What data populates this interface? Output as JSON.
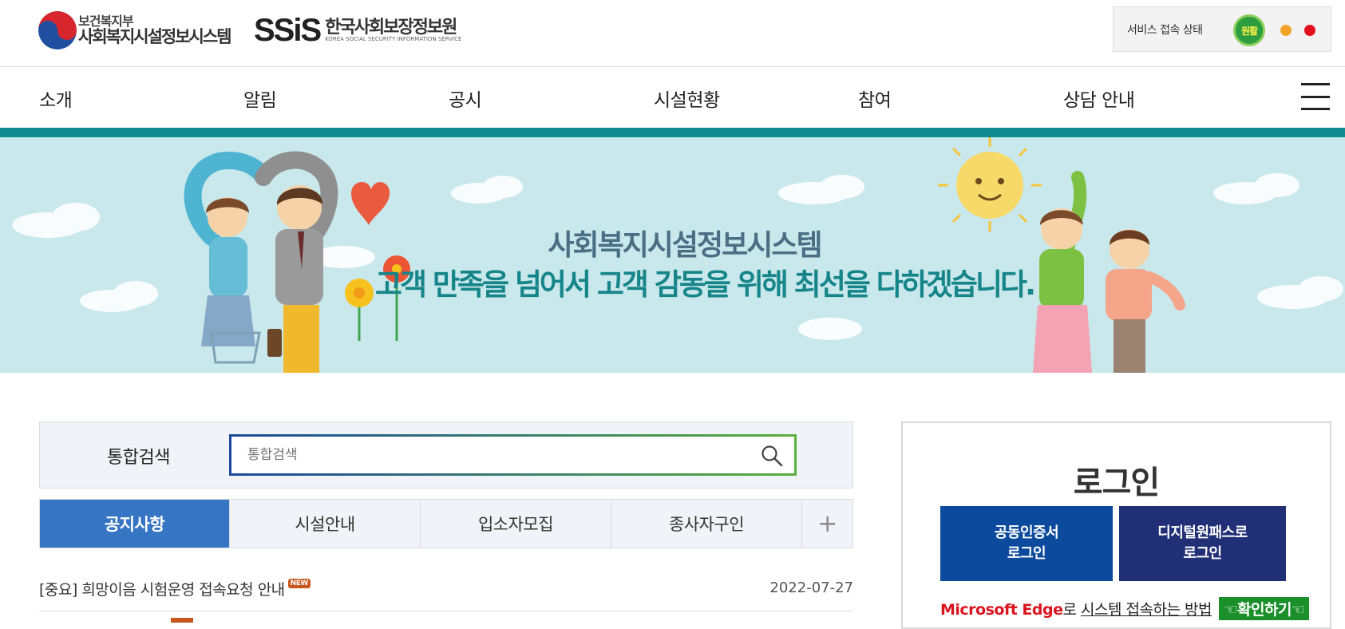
{
  "header": {
    "ministry_small": "보건복지부",
    "ministry_system": "사회복지시설정보시스템",
    "ssis_mark": "SSiS",
    "ssis_name": "한국사회보장정보원",
    "ssis_english": "KOREA SOCIAL SECURITY INFORMATION SERVICE",
    "service_status_label": "서비스 접속 상태",
    "service_status_value": "원활"
  },
  "nav": {
    "items": [
      {
        "label": "소개"
      },
      {
        "label": "알림"
      },
      {
        "label": "공시"
      },
      {
        "label": "시설현황"
      },
      {
        "label": "참여"
      },
      {
        "label": "상담 안내"
      }
    ]
  },
  "banner": {
    "title": "사회복지시설정보시스템",
    "subtitle": "고객 만족을 넘어서 고객 감동을 위해 최선을 다하겠습니다."
  },
  "search": {
    "label": "통합검색",
    "placeholder": "통합검색"
  },
  "tabs": [
    {
      "label": "공지사항",
      "active": true
    },
    {
      "label": "시설안내",
      "active": false
    },
    {
      "label": "입소자모집",
      "active": false
    },
    {
      "label": "종사자구인",
      "active": false
    },
    {
      "label": "+",
      "active": false
    }
  ],
  "notices": [
    {
      "title": "[중요] 희망이음 시험운영 접속요청 안내",
      "badge": "NEW",
      "date": "2022-07-27"
    }
  ],
  "login": {
    "title": "로그인",
    "cert_line1": "공동인증서",
    "cert_line2": "로그인",
    "digital_line1": "디지털원패스로",
    "digital_line2": "로그인",
    "edge_brand": "Microsoft Edge",
    "edge_suffix": "로",
    "edge_link": "시스템 접속하는 방법",
    "edge_confirm": "☜확인하기☜"
  },
  "colors": {
    "teal_bar": "#0f8a8e",
    "tab_active": "#3575c3",
    "cert_button": "#0b4a9c",
    "digital_button": "#212f77",
    "status_ok": "#2d9e3f"
  }
}
